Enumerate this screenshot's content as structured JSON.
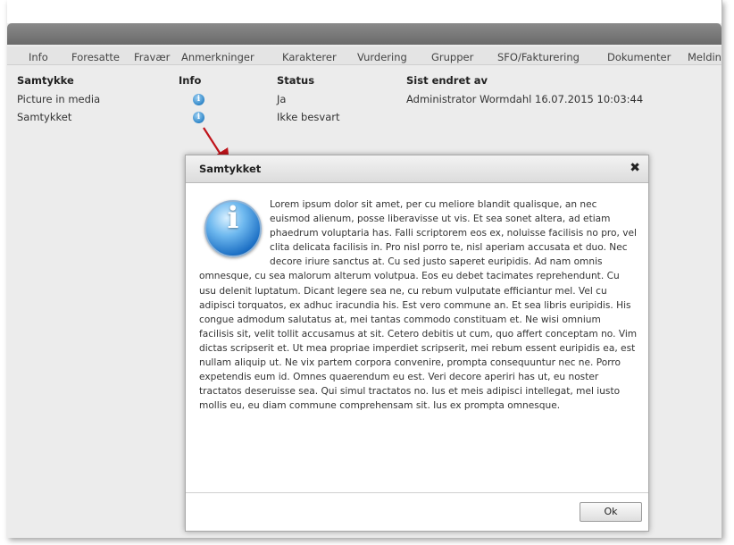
{
  "tabs": [
    "Info",
    "Foresatte",
    "Fravær",
    "Anmerkninger",
    "Karakterer",
    "Vurdering",
    "Grupper",
    "SFO/Fakturering",
    "Dokumenter",
    "Meldin"
  ],
  "table": {
    "headers": [
      "Samtykke",
      "Info",
      "Status",
      "Sist endret av"
    ],
    "rows": [
      {
        "name": "Picture in media",
        "status": "Ja",
        "changed_by": "Administrator Wormdahl 16.07.2015 10:03:44"
      },
      {
        "name": "Samtykket",
        "status": "Ikke besvart",
        "changed_by": ""
      }
    ]
  },
  "dialog": {
    "title": "Samtykket",
    "close_icon": "close-icon",
    "body": "Lorem ipsum dolor sit amet, per cu meliore blandit qualisque, an nec euismod alienum, posse liberavisse ut vis. Et sea sonet altera, ad etiam phaedrum voluptaria has. Falli scriptorem eos ex, noluisse facilisis no pro, vel clita delicata facilisis in. Pro nisl porro te, nisl aperiam accusata et duo. Nec decore iriure sanctus at. Cu sed justo saperet euripidis. Ad nam omnis omnesque, cu sea malorum alterum volutpua. Eos eu debet tacimates reprehendunt. Cu usu delenit luptatum. Dicant legere sea ne, cu rebum vulputate efficiantur mel. Vel cu adipisci torquatos, ex adhuc iracundia his. Est vero commune an. Et sea libris euripidis. His congue admodum salutatus at, mei tantas commodo constituam et. Ne wisi omnium facilisis sit, velit tollit accusamus at sit. Cetero debitis ut cum, quo affert conceptam no. Vim dictas scripserit et. Ut mea propriae imperdiet scripserit, mei rebum essent euripidis ea, est nullam aliquip ut. Ne vix partem corpora convenire, prompta consequuntur nec ne. Porro expetendis eum id. Omnes quaerendum eu est. Veri decore aperiri has ut, eu noster tractatos deseruisse sea. Qui simul tractatos no. Ius et meis adipisci intellegat, mel iusto mollis eu, eu diam commune comprehensam sit. Ius ex prompta omnesque.",
    "ok_label": "Ok"
  },
  "colors": {
    "header_bar": "#6a6a6a",
    "arrow": "#c0141b",
    "info_icon": "#2f86c8"
  }
}
